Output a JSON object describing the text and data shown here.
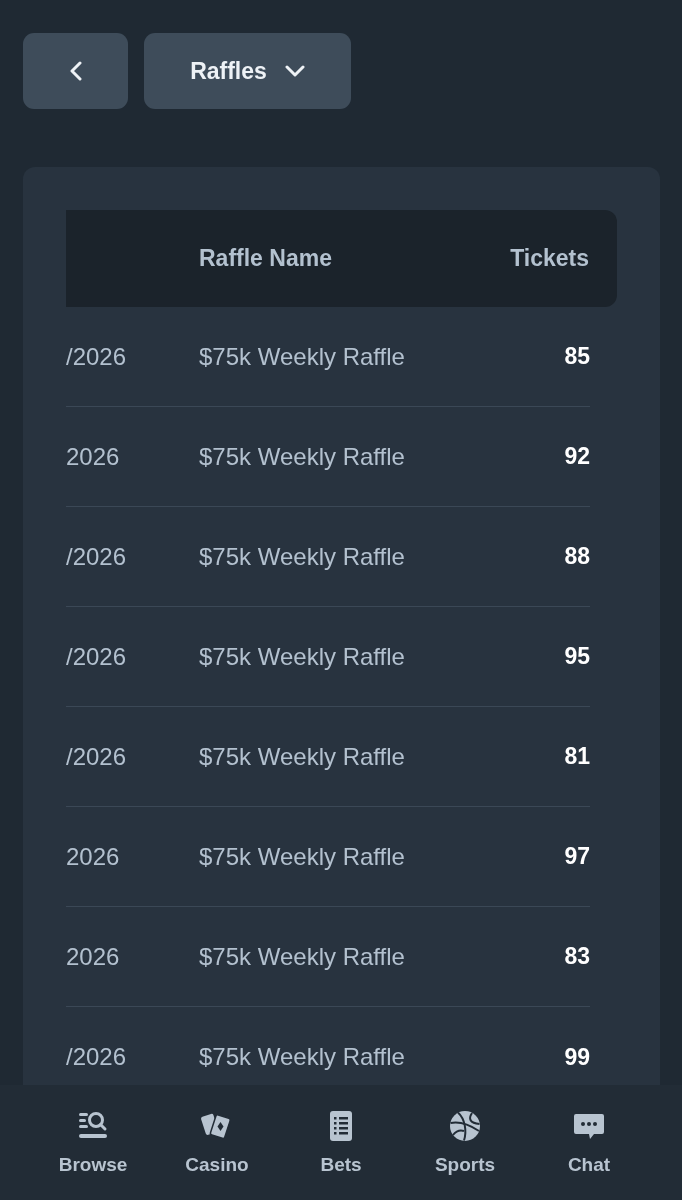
{
  "toolbar": {
    "dropdown": {
      "label": "Raffles"
    }
  },
  "table": {
    "headings": {
      "raffle_name": "Raffle Name",
      "tickets": "Tickets"
    },
    "rows": [
      {
        "column_1": "/2026",
        "raffle_name": "$75k Weekly Raffle",
        "tickets": "85"
      },
      {
        "column_1": "2026",
        "raffle_name": "$75k Weekly Raffle",
        "tickets": "92"
      },
      {
        "column_1": "/2026",
        "raffle_name": "$75k Weekly Raffle",
        "tickets": "88"
      },
      {
        "column_1": "/2026",
        "raffle_name": "$75k Weekly Raffle",
        "tickets": "95"
      },
      {
        "column_1": "/2026",
        "raffle_name": "$75k Weekly Raffle",
        "tickets": "81"
      },
      {
        "column_1": "2026",
        "raffle_name": "$75k Weekly Raffle",
        "tickets": "97"
      },
      {
        "column_1": "2026",
        "raffle_name": "$75k Weekly Raffle",
        "tickets": "83"
      },
      {
        "column_1": "/2026",
        "raffle_name": "$75k Weekly Raffle",
        "tickets": "99"
      }
    ]
  },
  "bottom_nav": [
    {
      "label": "Browse",
      "selected": false
    },
    {
      "label": "Casino",
      "selected": false
    },
    {
      "label": "Bets",
      "selected": false
    },
    {
      "label": "Sports",
      "selected": false
    },
    {
      "label": "Chat",
      "selected": false
    }
  ]
}
